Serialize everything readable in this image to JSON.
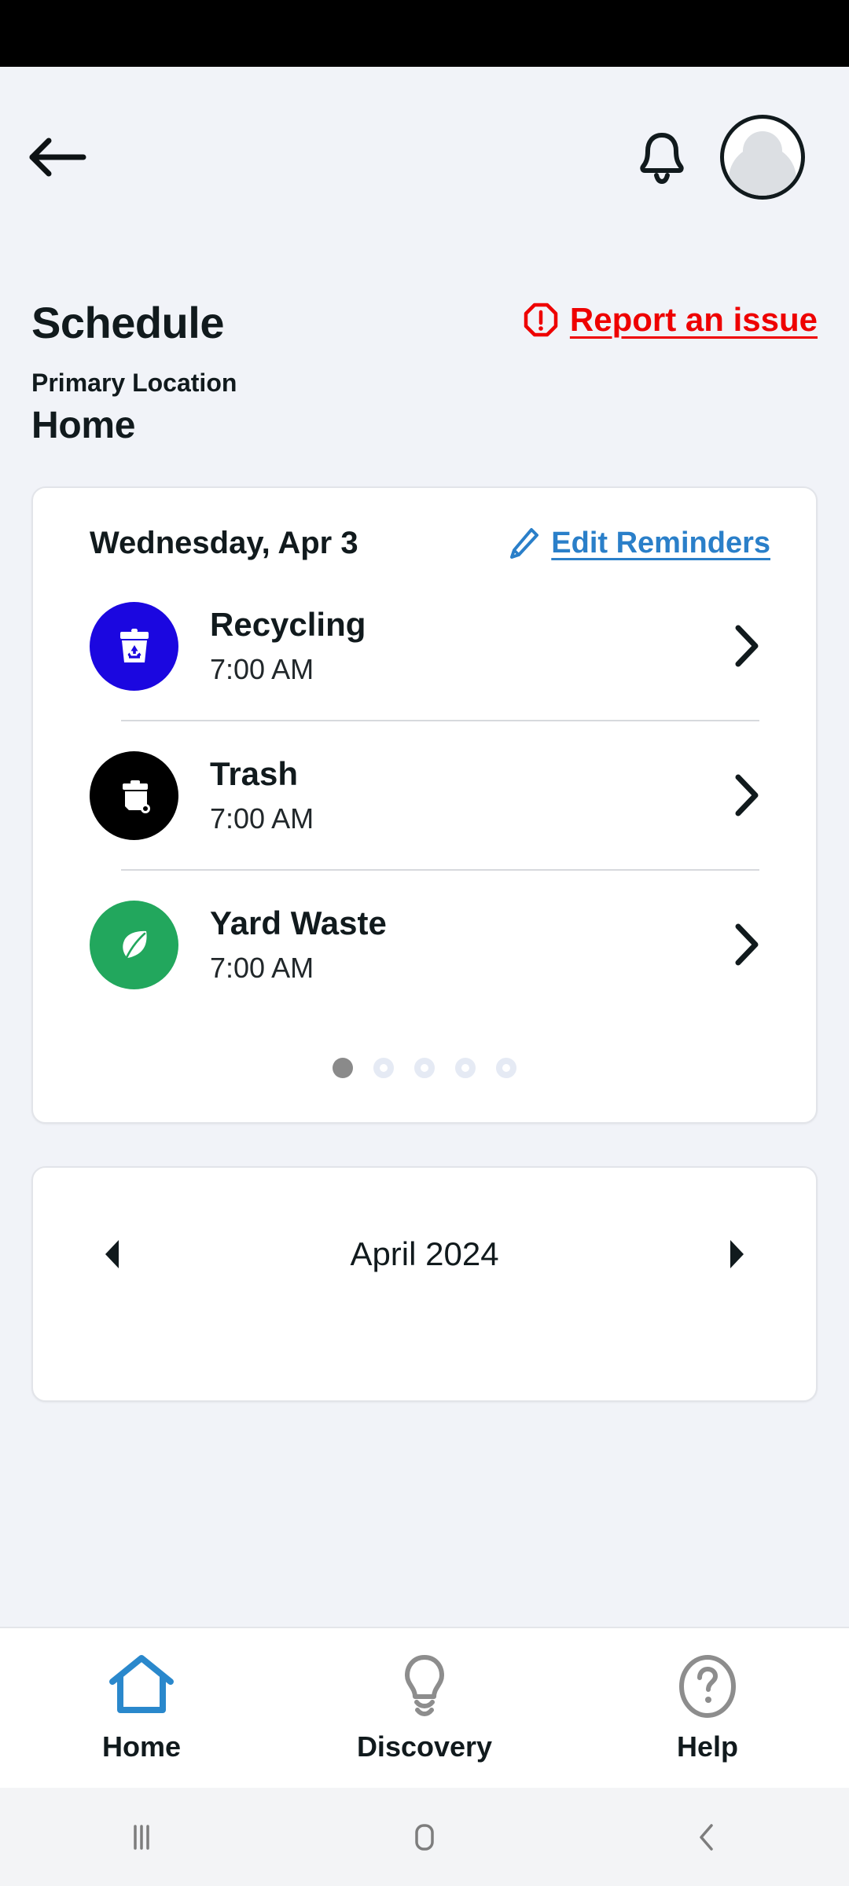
{
  "header": {
    "back_icon": "arrow-left-icon",
    "bell_icon": "bell-icon",
    "avatar_icon": "avatar-icon"
  },
  "page": {
    "title": "Schedule",
    "report_issue_label": "Report an issue",
    "report_issue_icon": "alert-octagon-icon",
    "report_issue_color": "#ee0000",
    "location_label": "Primary Location",
    "location_value": "Home"
  },
  "schedule_card": {
    "date": "Wednesday, Apr 3",
    "edit_label": "Edit Reminders",
    "edit_icon": "pencil-icon",
    "edit_color": "#2a7fc9",
    "pickups": [
      {
        "name": "Recycling",
        "time": "7:00 AM",
        "icon": "recycling-bin-icon",
        "color": "#1b07e0"
      },
      {
        "name": "Trash",
        "time": "7:00 AM",
        "icon": "trash-cart-icon",
        "color": "#000000"
      },
      {
        "name": "Yard Waste",
        "time": "7:00 AM",
        "icon": "leaf-icon",
        "color": "#22a75d"
      }
    ],
    "pager": {
      "total": 5,
      "active_index": 0
    }
  },
  "calendar_card": {
    "prev_icon": "triangle-left-icon",
    "month_label": "April 2024",
    "next_icon": "triangle-right-icon"
  },
  "bottom_nav": {
    "active_index": 0,
    "active_color": "#2a88cc",
    "inactive_color": "#8d8d8d",
    "items": [
      {
        "label": "Home",
        "icon": "house-icon"
      },
      {
        "label": "Discovery",
        "icon": "lightbulb-icon"
      },
      {
        "label": "Help",
        "icon": "question-circle-icon"
      }
    ]
  },
  "system_nav": {
    "recents_icon": "recents-icon",
    "home_icon": "home-square-icon",
    "back_icon": "chevron-left-icon"
  }
}
